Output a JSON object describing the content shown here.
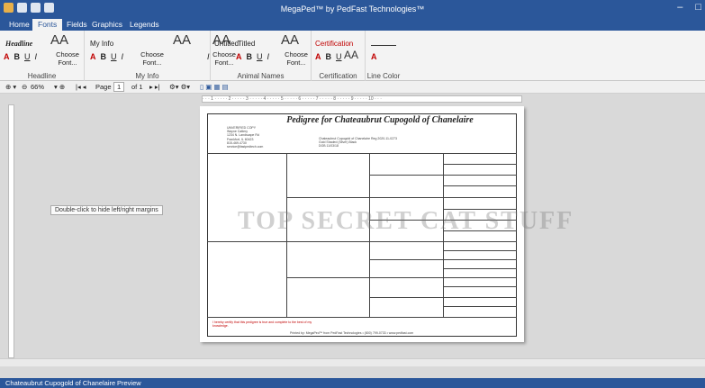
{
  "window": {
    "title": "MegaPed™ by PedFast Technologies™",
    "minimize": "–",
    "maximize": "□"
  },
  "tabs": [
    "Home",
    "Fonts",
    "Fields",
    "Graphics",
    "Legends"
  ],
  "active_tab": "Fonts",
  "ribbon": {
    "groups": [
      {
        "label": "Headline",
        "font_name": "Headline",
        "big": "AA",
        "choose": "Choose Font..."
      },
      {
        "label": "My Info",
        "font_name": "My Info",
        "big": "AA",
        "choose": "Choose Font..."
      },
      {
        "label": "Animal Names",
        "font_name": "Untitled",
        "big": "AA",
        "choose": "Choose Font...",
        "font_name2": "Titled",
        "big2": "AA",
        "choose2": "Choose Font..."
      },
      {
        "label": "Certification",
        "font_name": "Certification",
        "big": "AA",
        "choose": "Choose Font..."
      },
      {
        "label": "Line Color"
      }
    ],
    "fmt_buttons": [
      "A",
      "B",
      "U",
      "I"
    ]
  },
  "toolbar": {
    "zoom": "66%",
    "page_label": "Page",
    "page_value": "1",
    "of_pages": "of 1"
  },
  "hint": "Double-click to hide left/right margins",
  "pedigree": {
    "title": "Pedigree for Chateaubrut Cupogold of Chanelaire",
    "unofficial": "UNVERIFIED COPY",
    "owner_lines": [
      "Wayne Cattery",
      "1234 N. Landscape Rd",
      "Frankfort, IL 60423",
      "815-469-4730",
      "service@fastpedtech.com"
    ],
    "info_lines": [
      "Chateaubrut Cupogold of Chanelaire Reg 2020-11-0273",
      "Gold Shaded (Silver) Black",
      "DOB 11/03/18"
    ],
    "watermark": "TOP SECRET CAT STUFF",
    "certify": "I hereby certify that this pedigree is true and complete to the best of my knowledge.",
    "footer": "Printed by: MegaPed™ from PedFast Technologies • (800) 799-0733 • www.pedfast.com"
  },
  "statusbar": {
    "file": "Chateaubrut Cupogold of Chanelaire",
    "mode": "Preview"
  }
}
